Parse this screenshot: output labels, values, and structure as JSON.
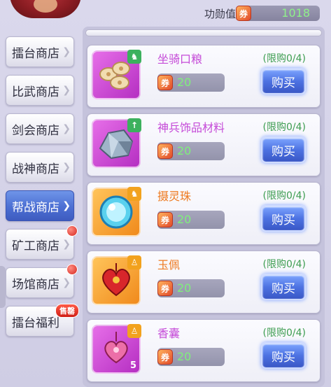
{
  "header": {
    "merit_label": "功勋值",
    "merit_value": "1018"
  },
  "sidebar": {
    "items": [
      {
        "label": "擂台商店",
        "active": false
      },
      {
        "label": "比武商店",
        "active": false
      },
      {
        "label": "剑会商店",
        "active": false
      },
      {
        "label": "战神商店",
        "active": false
      },
      {
        "label": "帮战商店",
        "active": true
      },
      {
        "label": "矿工商店",
        "active": false
      },
      {
        "label": "场馆商店",
        "active": false
      },
      {
        "label": "擂台福利",
        "active": false,
        "badge": "售罄"
      }
    ]
  },
  "shop": {
    "items": [
      {
        "name": "坐骑口粮",
        "limit": "(限购0/4)",
        "price": "20",
        "buy_label": "购买",
        "rarity": "purple",
        "icon": "horse-feed-icon"
      },
      {
        "name": "神兵饰品材料",
        "limit": "(限购0/4)",
        "price": "20",
        "buy_label": "购买",
        "rarity": "purple",
        "icon": "ore-crystal-icon"
      },
      {
        "name": "摄灵珠",
        "limit": "(限购0/4)",
        "price": "20",
        "buy_label": "购买",
        "rarity": "orange",
        "icon": "spirit-orb-icon"
      },
      {
        "name": "玉佩",
        "limit": "(限购0/4)",
        "price": "20",
        "buy_label": "购买",
        "rarity": "orange",
        "icon": "jade-pendant-icon"
      },
      {
        "name": "香囊",
        "limit": "(限购0/4)",
        "price": "20",
        "buy_label": "购买",
        "rarity": "purple",
        "icon": "sachet-icon",
        "qty": "5"
      }
    ]
  },
  "colors": {
    "accent_blue": "#4d72e2",
    "limit_green": "#3d9d50",
    "price_green": "#7ff07b",
    "purple_name": "#c54bd8",
    "orange_name": "#ee7a20"
  }
}
